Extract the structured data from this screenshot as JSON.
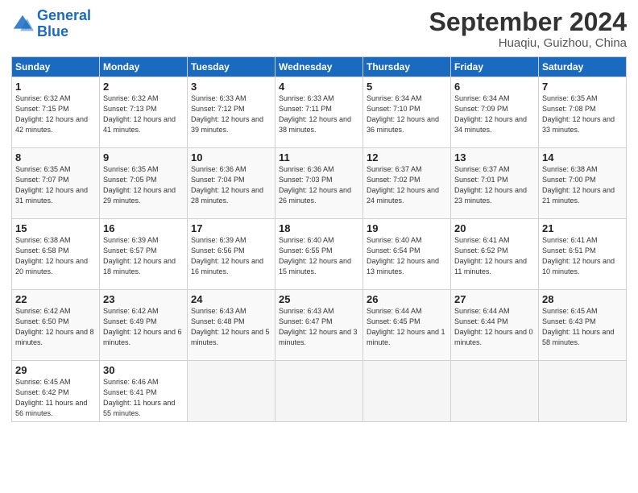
{
  "header": {
    "logo_general": "General",
    "logo_blue": "Blue",
    "month": "September 2024",
    "location": "Huaqiu, Guizhou, China"
  },
  "weekdays": [
    "Sunday",
    "Monday",
    "Tuesday",
    "Wednesday",
    "Thursday",
    "Friday",
    "Saturday"
  ],
  "weeks": [
    [
      {
        "day": "1",
        "sunrise": "Sunrise: 6:32 AM",
        "sunset": "Sunset: 7:15 PM",
        "daylight": "Daylight: 12 hours and 42 minutes."
      },
      {
        "day": "2",
        "sunrise": "Sunrise: 6:32 AM",
        "sunset": "Sunset: 7:13 PM",
        "daylight": "Daylight: 12 hours and 41 minutes."
      },
      {
        "day": "3",
        "sunrise": "Sunrise: 6:33 AM",
        "sunset": "Sunset: 7:12 PM",
        "daylight": "Daylight: 12 hours and 39 minutes."
      },
      {
        "day": "4",
        "sunrise": "Sunrise: 6:33 AM",
        "sunset": "Sunset: 7:11 PM",
        "daylight": "Daylight: 12 hours and 38 minutes."
      },
      {
        "day": "5",
        "sunrise": "Sunrise: 6:34 AM",
        "sunset": "Sunset: 7:10 PM",
        "daylight": "Daylight: 12 hours and 36 minutes."
      },
      {
        "day": "6",
        "sunrise": "Sunrise: 6:34 AM",
        "sunset": "Sunset: 7:09 PM",
        "daylight": "Daylight: 12 hours and 34 minutes."
      },
      {
        "day": "7",
        "sunrise": "Sunrise: 6:35 AM",
        "sunset": "Sunset: 7:08 PM",
        "daylight": "Daylight: 12 hours and 33 minutes."
      }
    ],
    [
      {
        "day": "8",
        "sunrise": "Sunrise: 6:35 AM",
        "sunset": "Sunset: 7:07 PM",
        "daylight": "Daylight: 12 hours and 31 minutes."
      },
      {
        "day": "9",
        "sunrise": "Sunrise: 6:35 AM",
        "sunset": "Sunset: 7:05 PM",
        "daylight": "Daylight: 12 hours and 29 minutes."
      },
      {
        "day": "10",
        "sunrise": "Sunrise: 6:36 AM",
        "sunset": "Sunset: 7:04 PM",
        "daylight": "Daylight: 12 hours and 28 minutes."
      },
      {
        "day": "11",
        "sunrise": "Sunrise: 6:36 AM",
        "sunset": "Sunset: 7:03 PM",
        "daylight": "Daylight: 12 hours and 26 minutes."
      },
      {
        "day": "12",
        "sunrise": "Sunrise: 6:37 AM",
        "sunset": "Sunset: 7:02 PM",
        "daylight": "Daylight: 12 hours and 24 minutes."
      },
      {
        "day": "13",
        "sunrise": "Sunrise: 6:37 AM",
        "sunset": "Sunset: 7:01 PM",
        "daylight": "Daylight: 12 hours and 23 minutes."
      },
      {
        "day": "14",
        "sunrise": "Sunrise: 6:38 AM",
        "sunset": "Sunset: 7:00 PM",
        "daylight": "Daylight: 12 hours and 21 minutes."
      }
    ],
    [
      {
        "day": "15",
        "sunrise": "Sunrise: 6:38 AM",
        "sunset": "Sunset: 6:58 PM",
        "daylight": "Daylight: 12 hours and 20 minutes."
      },
      {
        "day": "16",
        "sunrise": "Sunrise: 6:39 AM",
        "sunset": "Sunset: 6:57 PM",
        "daylight": "Daylight: 12 hours and 18 minutes."
      },
      {
        "day": "17",
        "sunrise": "Sunrise: 6:39 AM",
        "sunset": "Sunset: 6:56 PM",
        "daylight": "Daylight: 12 hours and 16 minutes."
      },
      {
        "day": "18",
        "sunrise": "Sunrise: 6:40 AM",
        "sunset": "Sunset: 6:55 PM",
        "daylight": "Daylight: 12 hours and 15 minutes."
      },
      {
        "day": "19",
        "sunrise": "Sunrise: 6:40 AM",
        "sunset": "Sunset: 6:54 PM",
        "daylight": "Daylight: 12 hours and 13 minutes."
      },
      {
        "day": "20",
        "sunrise": "Sunrise: 6:41 AM",
        "sunset": "Sunset: 6:52 PM",
        "daylight": "Daylight: 12 hours and 11 minutes."
      },
      {
        "day": "21",
        "sunrise": "Sunrise: 6:41 AM",
        "sunset": "Sunset: 6:51 PM",
        "daylight": "Daylight: 12 hours and 10 minutes."
      }
    ],
    [
      {
        "day": "22",
        "sunrise": "Sunrise: 6:42 AM",
        "sunset": "Sunset: 6:50 PM",
        "daylight": "Daylight: 12 hours and 8 minutes."
      },
      {
        "day": "23",
        "sunrise": "Sunrise: 6:42 AM",
        "sunset": "Sunset: 6:49 PM",
        "daylight": "Daylight: 12 hours and 6 minutes."
      },
      {
        "day": "24",
        "sunrise": "Sunrise: 6:43 AM",
        "sunset": "Sunset: 6:48 PM",
        "daylight": "Daylight: 12 hours and 5 minutes."
      },
      {
        "day": "25",
        "sunrise": "Sunrise: 6:43 AM",
        "sunset": "Sunset: 6:47 PM",
        "daylight": "Daylight: 12 hours and 3 minutes."
      },
      {
        "day": "26",
        "sunrise": "Sunrise: 6:44 AM",
        "sunset": "Sunset: 6:45 PM",
        "daylight": "Daylight: 12 hours and 1 minute."
      },
      {
        "day": "27",
        "sunrise": "Sunrise: 6:44 AM",
        "sunset": "Sunset: 6:44 PM",
        "daylight": "Daylight: 12 hours and 0 minutes."
      },
      {
        "day": "28",
        "sunrise": "Sunrise: 6:45 AM",
        "sunset": "Sunset: 6:43 PM",
        "daylight": "Daylight: 11 hours and 58 minutes."
      }
    ],
    [
      {
        "day": "29",
        "sunrise": "Sunrise: 6:45 AM",
        "sunset": "Sunset: 6:42 PM",
        "daylight": "Daylight: 11 hours and 56 minutes."
      },
      {
        "day": "30",
        "sunrise": "Sunrise: 6:46 AM",
        "sunset": "Sunset: 6:41 PM",
        "daylight": "Daylight: 11 hours and 55 minutes."
      },
      null,
      null,
      null,
      null,
      null
    ]
  ]
}
